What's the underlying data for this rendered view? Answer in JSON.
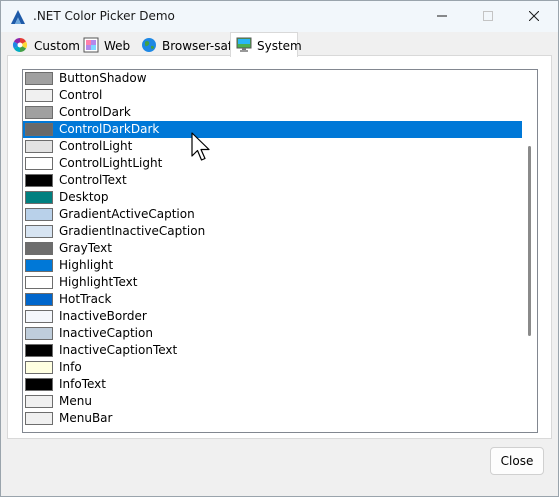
{
  "window": {
    "title": ".NET Color Picker Demo",
    "app_icon": "triangle-logo-icon"
  },
  "titlebar_buttons": {
    "minimize": "minimize-icon",
    "maximize": "maximize-icon",
    "close": "close-icon"
  },
  "tabs": [
    {
      "label": "Custom",
      "icon": "color-wheel-icon",
      "active": false
    },
    {
      "label": "Web",
      "icon": "web-palette-icon",
      "active": false
    },
    {
      "label": "Browser-safe",
      "icon": "globe-icon",
      "active": false
    },
    {
      "label": "System",
      "icon": "monitor-icon",
      "active": true
    }
  ],
  "colors": [
    {
      "name": "ButtonShadow",
      "color": "#a0a0a0"
    },
    {
      "name": "Control",
      "color": "#f0f0f0"
    },
    {
      "name": "ControlDark",
      "color": "#a0a0a0"
    },
    {
      "name": "ControlDarkDark",
      "color": "#696969"
    },
    {
      "name": "ControlLight",
      "color": "#e3e3e3"
    },
    {
      "name": "ControlLightLight",
      "color": "#ffffff"
    },
    {
      "name": "ControlText",
      "color": "#000000"
    },
    {
      "name": "Desktop",
      "color": "#008080"
    },
    {
      "name": "GradientActiveCaption",
      "color": "#b9d1ea"
    },
    {
      "name": "GradientInactiveCaption",
      "color": "#d7e4f2"
    },
    {
      "name": "GrayText",
      "color": "#6d6d6d"
    },
    {
      "name": "Highlight",
      "color": "#0078d7"
    },
    {
      "name": "HighlightText",
      "color": "#ffffff"
    },
    {
      "name": "HotTrack",
      "color": "#0066cc"
    },
    {
      "name": "InactiveBorder",
      "color": "#f4f7fc"
    },
    {
      "name": "InactiveCaption",
      "color": "#bfcddb"
    },
    {
      "name": "InactiveCaptionText",
      "color": "#000000"
    },
    {
      "name": "Info",
      "color": "#ffffe1"
    },
    {
      "name": "InfoText",
      "color": "#000000"
    },
    {
      "name": "Menu",
      "color": "#f0f0f0"
    },
    {
      "name": "MenuBar",
      "color": "#f0f0f0"
    }
  ],
  "selected_color": "ControlDarkDark",
  "selection_color": "#0078d7",
  "close_button": {
    "label": "Close"
  },
  "cursor": "arrow-cursor-icon"
}
